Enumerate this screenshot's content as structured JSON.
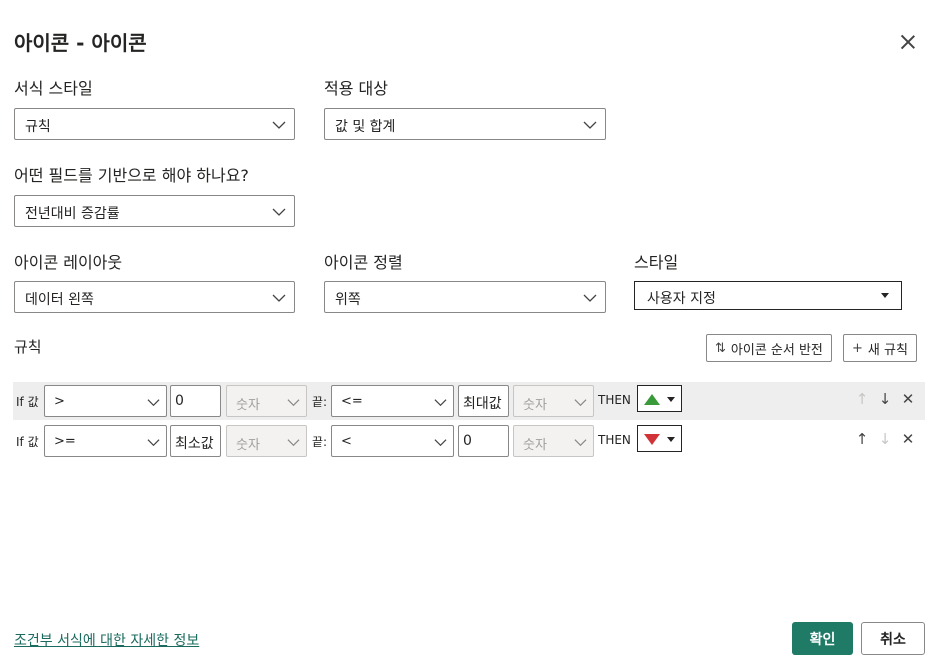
{
  "dialog": {
    "title": "아이콘 - 아이콘"
  },
  "format_style": {
    "label": "서식 스타일",
    "value": "규칙"
  },
  "apply_to": {
    "label": "적용 대상",
    "value": "값 및 합계"
  },
  "base_field": {
    "label": "어떤 필드를 기반으로 해야 하나요?",
    "value": "전년대비 증감률"
  },
  "icon_layout": {
    "label": "아이콘 레이아웃",
    "value": "데이터 왼쪽"
  },
  "icon_align": {
    "label": "아이콘 정렬",
    "value": "위쪽"
  },
  "style": {
    "label": "스타일",
    "value": "사용자 지정"
  },
  "rules": {
    "label": "규칙",
    "reverse_button": "아이콘 순서 반전",
    "new_rule_button": "새 규칙",
    "if_label": "If 값",
    "and_label": "끝:",
    "then_label": "THEN",
    "rows": [
      {
        "op1": ">",
        "val1": "0",
        "type1": "숫자",
        "op2": "<=",
        "val2": "최대값",
        "type2": "숫자",
        "icon": "green-up-triangle",
        "icon_color": "#3a9a3a"
      },
      {
        "op1": ">=",
        "val1": "최소값",
        "type1": "숫자",
        "op2": "<",
        "val2": "0",
        "type2": "숫자",
        "icon": "red-down-triangle",
        "icon_color": "#d13438"
      }
    ]
  },
  "footer": {
    "link": "조건부 서식에 대한 자세한 정보",
    "ok_button": "확인",
    "cancel_button": "취소"
  },
  "colors": {
    "primary": "#1f7a66",
    "link": "#1a6b5e",
    "border": "#8a8886"
  }
}
